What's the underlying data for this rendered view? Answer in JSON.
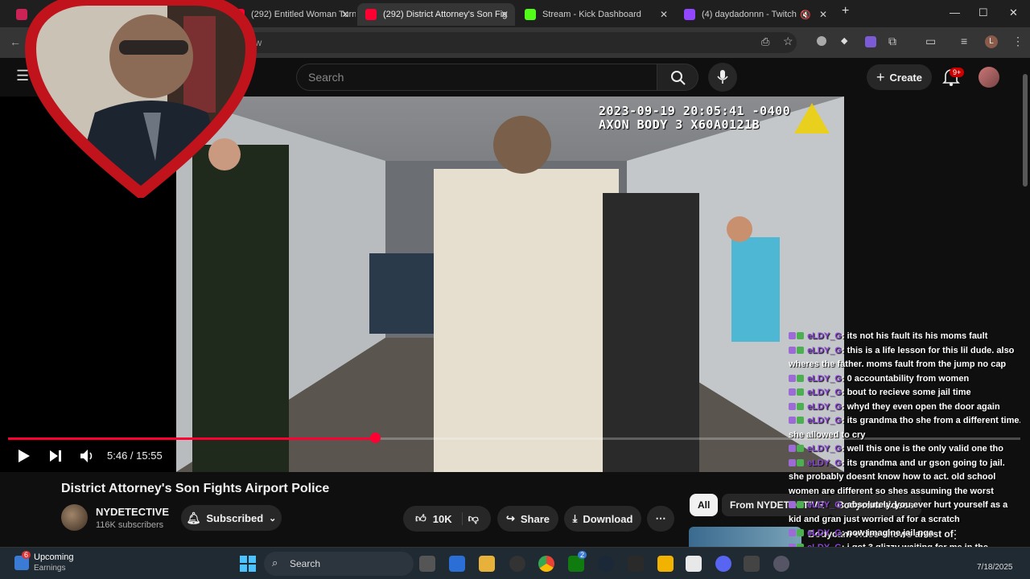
{
  "browser": {
    "tabs": [
      {
        "label": "",
        "favicon_color": "#cc0000"
      },
      {
        "label": "(292) Entitled Woman Turns a S",
        "favicon_color": "#ff0033"
      },
      {
        "label": "(292) District Attorney's Son Fig",
        "favicon_color": "#ff0033",
        "active": true
      },
      {
        "label": "Stream - Kick Dashboard",
        "favicon_color": "#53fc18"
      },
      {
        "label": "(4) daydadonnn - Twitch",
        "favicon_color": "#9146ff"
      }
    ],
    "new_tab": "+",
    "omnibox_text": "ow",
    "controls": {
      "minimize": "—",
      "maximize": "☐",
      "close": "✕"
    }
  },
  "youtube": {
    "search_placeholder": "Search",
    "create_label": "Create",
    "notification_badge": "9+"
  },
  "video": {
    "hud_line1": "2023-09-19 20:05:41 -0400",
    "hud_line2": "AXON BODY 3 X60A0121B",
    "time": "5:46 / 15:55",
    "progress_fraction": 0.362,
    "title": "District Attorney's Son Fights Airport Police",
    "channel": "NYDETECTIVE",
    "subscribers": "116K subscribers",
    "subscribed_label": "Subscribed",
    "likes": "10K",
    "share_label": "Share",
    "download_label": "Download",
    "more_label": "⋯"
  },
  "chips": {
    "all": "All",
    "from_channel": "From NYDETECTIVE",
    "bodycam": "Bodycam videos"
  },
  "related": {
    "title": "Bodycam video shows arrest of"
  },
  "chat": {
    "username": "eLDY_G",
    "messages": [
      {
        "text": ": its not his fault its his moms fault"
      },
      {
        "text": ": this is a life lesson for this lil dude. also wheres the father. moms fault from the jump no cap"
      },
      {
        "text": ": 0 accountability from women"
      },
      {
        "text": ": bout to recieve some jail time"
      },
      {
        "text": ": whyd they even open the door again"
      },
      {
        "text": ": its grandma tho she from a different time. she allowed to cry"
      },
      {
        "text": ": well this one is the only valid one tho"
      },
      {
        "text": ": its grandma and ur gson going to jail. she probably doesnt know how to act. old school women are different so shes assuming the worst"
      },
      {
        "text": ": absolutely. you ever hurt yourself as a kid and gran just worried af for a scratch"
      },
      {
        "text": ": now imagine jail nga"
      },
      {
        "text": ": i got 3 glizzy waiting for me in the toaster. ayooo pause gunna put everything on it...pause"
      }
    ]
  },
  "taskbar": {
    "widget_title": "Upcoming",
    "widget_sub": "Earnings",
    "widget_badge": "6",
    "search_label": "Search",
    "date": "7/18/2025",
    "store_badge": "2"
  },
  "colors": {
    "accent": "#ff0033",
    "chat_user": "#8d48d8",
    "background": "#0f0f0f"
  }
}
